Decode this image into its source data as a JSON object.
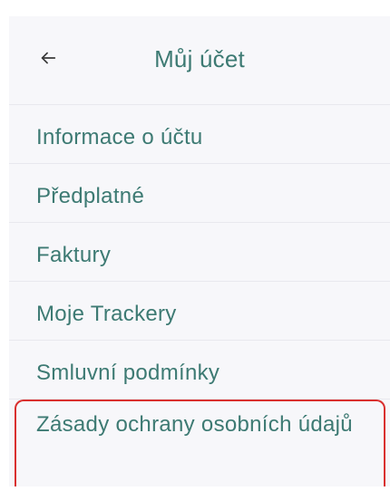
{
  "header": {
    "title": "Můj účet",
    "back_icon": "arrow-left-icon"
  },
  "menu": {
    "items": [
      {
        "label": "Informace o účtu"
      },
      {
        "label": "Předplatné"
      },
      {
        "label": "Faktury"
      },
      {
        "label": "Moje Trackery"
      },
      {
        "label": "Smluvní podmínky"
      },
      {
        "label": "Zásady ochrany osobních údajů"
      }
    ]
  },
  "colors": {
    "accent": "#3d7a73",
    "highlight_border": "#d9302f",
    "background": "#f7f7fa"
  }
}
